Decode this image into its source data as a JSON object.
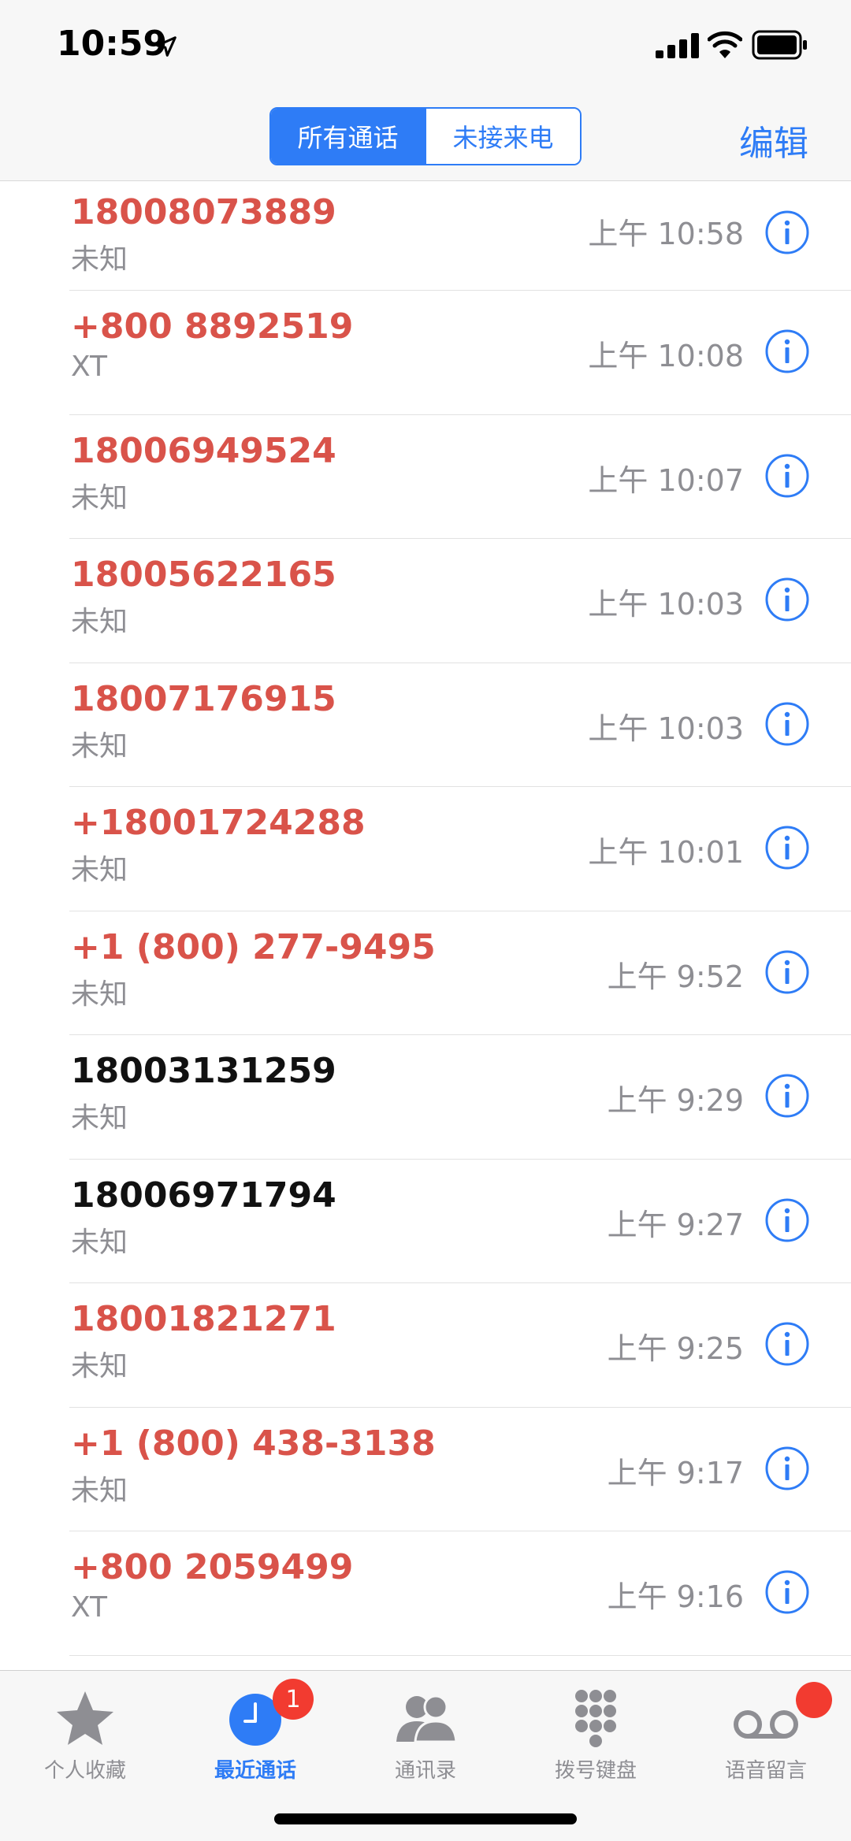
{
  "status_bar": {
    "time": "10:59"
  },
  "nav": {
    "segments": [
      {
        "label": "所有通话",
        "active": true
      },
      {
        "label": "未接来电",
        "active": false
      }
    ],
    "edit_label": "编辑"
  },
  "calls": [
    {
      "number": "18008073889",
      "label": "未知",
      "time": "上午 10:58",
      "missed": true
    },
    {
      "number": "+800 8892519",
      "label": "XT",
      "time": "上午 10:08",
      "missed": true
    },
    {
      "number": "18006949524",
      "label": "未知",
      "time": "上午 10:07",
      "missed": true
    },
    {
      "number": "18005622165",
      "label": "未知",
      "time": "上午 10:03",
      "missed": true
    },
    {
      "number": "18007176915",
      "label": "未知",
      "time": "上午 10:03",
      "missed": true
    },
    {
      "number": "+18001724288",
      "label": "未知",
      "time": "上午 10:01",
      "missed": true
    },
    {
      "number": "+1 (800) 277-9495",
      "label": "未知",
      "time": "上午 9:52",
      "missed": true
    },
    {
      "number": "18003131259",
      "label": "未知",
      "time": "上午 9:29",
      "missed": false
    },
    {
      "number": "18006971794",
      "label": "未知",
      "time": "上午 9:27",
      "missed": false
    },
    {
      "number": "18001821271",
      "label": "未知",
      "time": "上午 9:25",
      "missed": true
    },
    {
      "number": "+1 (800) 438-3138",
      "label": "未知",
      "time": "上午 9:17",
      "missed": true
    },
    {
      "number": "+800 2059499",
      "label": "XT",
      "time": "上午 9:16",
      "missed": true
    }
  ],
  "tabs": [
    {
      "label": "个人收藏",
      "icon": "star-icon",
      "active": false
    },
    {
      "label": "最近通话",
      "icon": "clock-icon",
      "active": true,
      "badge": "1"
    },
    {
      "label": "通讯录",
      "icon": "contacts-icon",
      "active": false
    },
    {
      "label": "拨号键盘",
      "icon": "keypad-icon",
      "active": false
    },
    {
      "label": "语音留言",
      "icon": "voicemail-icon",
      "active": false
    }
  ],
  "colors": {
    "accent": "#2e7cf6",
    "missed": "#d9534a",
    "secondary_text": "#8e8e93",
    "badge": "#f23b30"
  }
}
